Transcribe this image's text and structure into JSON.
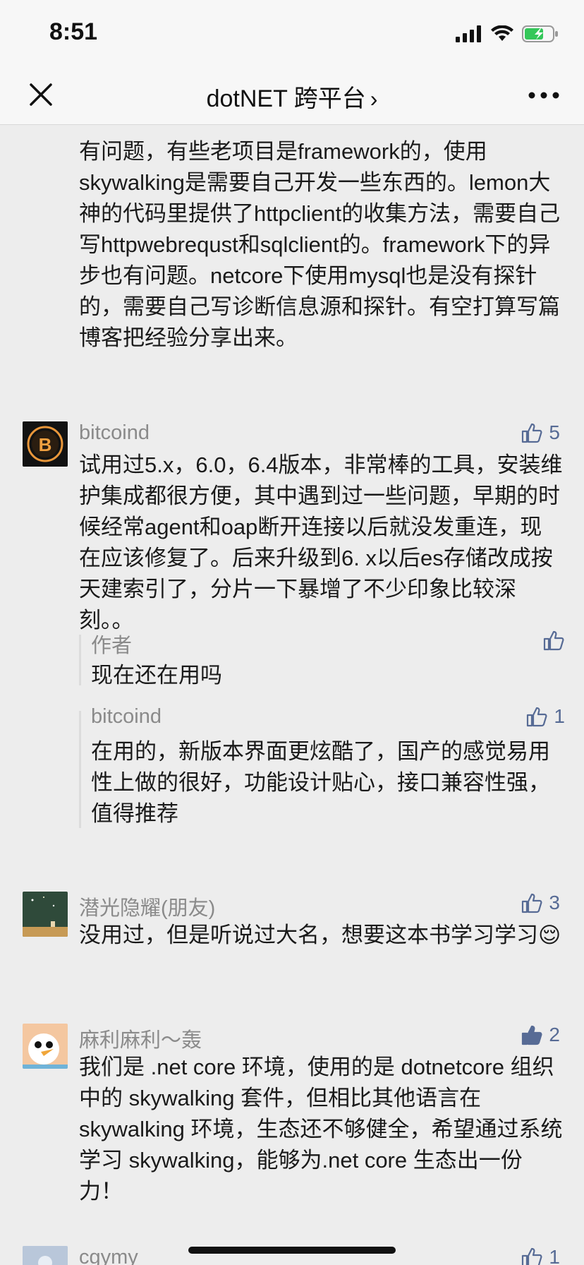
{
  "status": {
    "time": "8:51"
  },
  "nav": {
    "title": "dotNET 跨平台",
    "chevron": "›"
  },
  "partial_top": {
    "text": "有问题，有些老项目是framework的，使用skywalking是需要自己开发一些东西的。lemon大神的代码里提供了httpclient的收集方法，需要自己写httpwebrequst和sqlclient的。framework下的异步也有问题。netcore下使用mysql也是没有探针的，需要自己写诊断信息源和探针。有空打算写篇博客把经验分享出来。"
  },
  "comments": [
    {
      "name": "bitcoind",
      "likes": "5",
      "text": "试用过5.x，6.0，6.4版本，非常棒的工具，安装维护集成都很方便，其中遇到过一些问题，早期的时候经常agent和oap断开连接以后就没发重连，现在应该修复了。后来升级到6. x以后es存储改成按天建索引了，分片一下暴增了不少印象比较深刻。。",
      "replies": [
        {
          "name": "作者",
          "text": "现在还在用吗",
          "likes": ""
        },
        {
          "name": "bitcoind",
          "text": "在用的，新版本界面更炫酷了，国产的感觉易用性上做的很好，功能设计贴心，接口兼容性强，值得推荐",
          "likes": "1"
        }
      ]
    },
    {
      "name": "潜光隐耀(朋友)",
      "likes": "3",
      "text": "没用过，但是听说过大名，想要这本书学习学习😌"
    },
    {
      "name": "麻利麻利～轰",
      "likes": "2",
      "text": "我们是 .net core 环境，使用的是 dotnetcore 组织中的 skywalking 套件，但相比其他语言在 skywalking 环境，生态还不够健全，希望通过系统学习 skywalking，能够为.net core 生态出一份力！"
    },
    {
      "name": "cgymy",
      "likes": "1"
    }
  ],
  "colors": {
    "accent": "#576b95",
    "name": "#8a8a8a",
    "text": "#1a1a1a",
    "bg": "#ededed"
  }
}
